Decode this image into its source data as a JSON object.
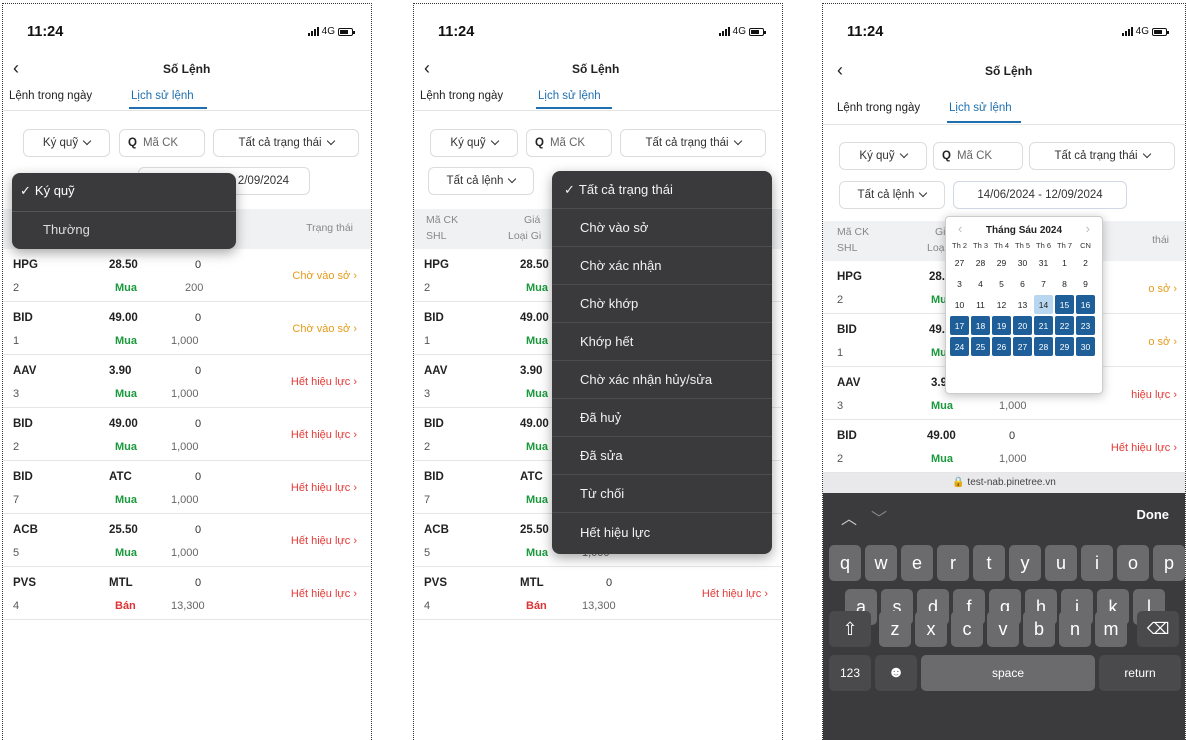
{
  "status": {
    "time": "11:24",
    "network": "4G"
  },
  "header": {
    "title": "Số Lệnh"
  },
  "tabs": [
    "Lệnh trong ngày",
    "Lịch sử lệnh"
  ],
  "filters": {
    "account": "Ký quỹ",
    "search_placeholder": "Mã CK",
    "status": "Tất cả trạng thái",
    "order_type": "Tất cả lệnh",
    "date_range": "14/06/2024 - 12/09/2024",
    "date_range_partial": "2/09/2024"
  },
  "table_headers": {
    "symbol": "Mã CK",
    "shl": "SHL",
    "price": "Giá",
    "type": "Loại GD",
    "status": "Trạng thái"
  },
  "account_dropdown": {
    "checkmark": "✓",
    "options": [
      "Ký quỹ",
      "Thường"
    ]
  },
  "status_dropdown": {
    "options": [
      "Tất cả trạng thái",
      "Chờ vào sở",
      "Chờ xác nhận",
      "Chờ khớp",
      "Khớp hết",
      "Chờ xác nhận hủy/sửa",
      "Đã huỷ",
      "Đã sửa",
      "Từ chối",
      "Hết hiệu lực"
    ]
  },
  "orders": [
    {
      "sym": "HPG",
      "shl": "2",
      "price": "28.50",
      "side": "Mua",
      "matched": "0",
      "qty": "200",
      "status": "Chờ vào sở",
      "kind": "y"
    },
    {
      "sym": "BID",
      "shl": "1",
      "price": "49.00",
      "side": "Mua",
      "matched": "0",
      "qty": "1,000",
      "status": "Chờ vào sở",
      "kind": "y"
    },
    {
      "sym": "AAV",
      "shl": "3",
      "price": "3.90",
      "side": "Mua",
      "matched": "0",
      "qty": "1,000",
      "status": "Hết hiệu lực",
      "kind": "r"
    },
    {
      "sym": "BID",
      "shl": "2",
      "price": "49.00",
      "side": "Mua",
      "matched": "0",
      "qty": "1,000",
      "status": "Hết hiệu lực",
      "kind": "r"
    },
    {
      "sym": "BID",
      "shl": "7",
      "price": "ATC",
      "side": "Mua",
      "matched": "0",
      "qty": "1,000",
      "status": "Hết hiệu lực",
      "kind": "r"
    },
    {
      "sym": "ACB",
      "shl": "5",
      "price": "25.50",
      "side": "Mua",
      "matched": "0",
      "qty": "1,000",
      "status": "Hết hiệu lực",
      "kind": "r"
    },
    {
      "sym": "PVS",
      "shl": "4",
      "price": "MTL",
      "side": "Bán",
      "matched": "0",
      "qty": "13,300",
      "status": "Hết hiệu lực",
      "kind": "r"
    }
  ],
  "panel3_partial": {
    "hpg_price": "28.",
    "buy_short": "Mu",
    "bid_price": "49.",
    "aav_price": "3.9",
    "aav_status_partial": "hiệu lực",
    "status_partial": "o sở",
    "thai_partial": "thái",
    "gia_partial": "Gi",
    "loai_partial": "Loại"
  },
  "panel2_partial": {
    "loai_partial": "Loại Gi"
  },
  "panel1_partial": {
    "thuong_visible": "Thường"
  },
  "calendar": {
    "month": "Tháng Sáu 2024",
    "weekdays": [
      "Th 2",
      "Th 3",
      "Th 4",
      "Th 5",
      "Th 6",
      "Th 7",
      "CN"
    ],
    "days": [
      "27",
      "28",
      "29",
      "30",
      "31",
      "1",
      "2",
      "3",
      "4",
      "5",
      "6",
      "7",
      "8",
      "9",
      "10",
      "11",
      "12",
      "13",
      "14",
      "15",
      "16",
      "17",
      "18",
      "19",
      "20",
      "21",
      "22",
      "23",
      "24",
      "25",
      "26",
      "27",
      "28",
      "29",
      "30"
    ],
    "today_index": 18,
    "selected_start_index": 19
  },
  "browser_bar": {
    "url": "test-nab.pinetree.vn"
  },
  "keyboard": {
    "done": "Done",
    "row1": [
      "q",
      "w",
      "e",
      "r",
      "t",
      "y",
      "u",
      "i",
      "o",
      "p"
    ],
    "row2": [
      "a",
      "s",
      "d",
      "f",
      "g",
      "h",
      "j",
      "k",
      "l"
    ],
    "row3": [
      "z",
      "x",
      "c",
      "v",
      "b",
      "n",
      "m"
    ],
    "numbers": "123",
    "space": "space",
    "return": "return"
  }
}
